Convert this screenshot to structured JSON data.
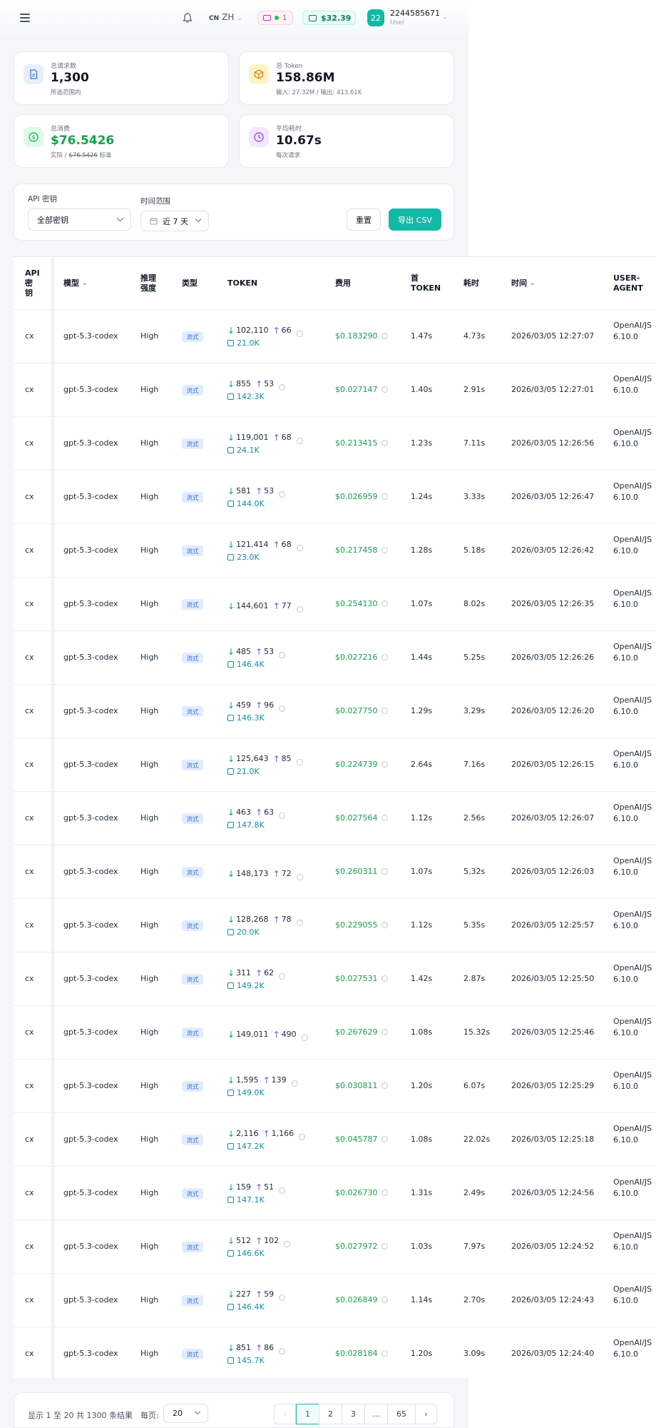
{
  "header": {
    "lang_flag": "CN",
    "lang_label": "ZH",
    "subscription_count": "1",
    "balance": "$32.39",
    "avatar_text": "22",
    "user_name": "2244585671",
    "user_role": "User"
  },
  "stats": {
    "requests": {
      "label": "总请求数",
      "value": "1,300",
      "sub": "所选范围内"
    },
    "tokens": {
      "label": "总 Token",
      "value": "158.86M",
      "sub": "输入: 27.32M / 输出: 413.61K"
    },
    "cost": {
      "label": "总消费",
      "value": "$76.5426",
      "sub_prefix": "实际 / ",
      "sub_strike": "$76.5426",
      "sub_suffix": " 标准"
    },
    "latency": {
      "label": "平均耗时",
      "value": "10.67s",
      "sub": "每次请求"
    }
  },
  "filters": {
    "api_key_label": "API 密钥",
    "api_key_value": "全部密钥",
    "time_range_label": "时间范围",
    "time_range_value": "近 7 天",
    "reset_label": "重置",
    "export_label": "导出 CSV"
  },
  "table": {
    "headers": {
      "api_key": "API\n密\n钥",
      "model": "模型",
      "reasoning": "推理\n强度",
      "type": "类型",
      "token": "TOKEN",
      "cost": "费用",
      "first_token": "首\nTOKEN",
      "duration": "耗时",
      "time": "时间",
      "user_agent": "USER-\nAGENT"
    },
    "rows": [
      {
        "key": "cx",
        "model": "gpt-5.3-codex",
        "effort": "High",
        "type": "流式",
        "in": "102,110",
        "out": "66",
        "cache": "21.0K",
        "cost": "$0.183290",
        "first": "1.47s",
        "dur": "4.73s",
        "time": "2026/03/05 12:27:07",
        "ua": "OpenAI/JS 6.10.0"
      },
      {
        "key": "cx",
        "model": "gpt-5.3-codex",
        "effort": "High",
        "type": "流式",
        "in": "855",
        "out": "53",
        "cache": "142.3K",
        "cost": "$0.027147",
        "first": "1.40s",
        "dur": "2.91s",
        "time": "2026/03/05 12:27:01",
        "ua": "OpenAI/JS 6.10.0"
      },
      {
        "key": "cx",
        "model": "gpt-5.3-codex",
        "effort": "High",
        "type": "流式",
        "in": "119,001",
        "out": "68",
        "cache": "24.1K",
        "cost": "$0.213415",
        "first": "1.23s",
        "dur": "7.11s",
        "time": "2026/03/05 12:26:56",
        "ua": "OpenAI/JS 6.10.0"
      },
      {
        "key": "cx",
        "model": "gpt-5.3-codex",
        "effort": "High",
        "type": "流式",
        "in": "581",
        "out": "53",
        "cache": "144.0K",
        "cost": "$0.026959",
        "first": "1.24s",
        "dur": "3.33s",
        "time": "2026/03/05 12:26:47",
        "ua": "OpenAI/JS 6.10.0"
      },
      {
        "key": "cx",
        "model": "gpt-5.3-codex",
        "effort": "High",
        "type": "流式",
        "in": "121,414",
        "out": "68",
        "cache": "23.0K",
        "cost": "$0.217458",
        "first": "1.28s",
        "dur": "5.18s",
        "time": "2026/03/05 12:26:42",
        "ua": "OpenAI/JS 6.10.0"
      },
      {
        "key": "cx",
        "model": "gpt-5.3-codex",
        "effort": "High",
        "type": "流式",
        "in": "144,601",
        "out": "77",
        "cache": "",
        "cost": "$0.254130",
        "first": "1.07s",
        "dur": "8.02s",
        "time": "2026/03/05 12:26:35",
        "ua": "OpenAI/JS 6.10.0"
      },
      {
        "key": "cx",
        "model": "gpt-5.3-codex",
        "effort": "High",
        "type": "流式",
        "in": "485",
        "out": "53",
        "cache": "146.4K",
        "cost": "$0.027216",
        "first": "1.44s",
        "dur": "5.25s",
        "time": "2026/03/05 12:26:26",
        "ua": "OpenAI/JS 6.10.0"
      },
      {
        "key": "cx",
        "model": "gpt-5.3-codex",
        "effort": "High",
        "type": "流式",
        "in": "459",
        "out": "96",
        "cache": "146.3K",
        "cost": "$0.027750",
        "first": "1.29s",
        "dur": "3.29s",
        "time": "2026/03/05 12:26:20",
        "ua": "OpenAI/JS 6.10.0"
      },
      {
        "key": "cx",
        "model": "gpt-5.3-codex",
        "effort": "High",
        "type": "流式",
        "in": "125,643",
        "out": "85",
        "cache": "21.0K",
        "cost": "$0.224739",
        "first": "2.64s",
        "dur": "7.16s",
        "time": "2026/03/05 12:26:15",
        "ua": "OpenAI/JS 6.10.0"
      },
      {
        "key": "cx",
        "model": "gpt-5.3-codex",
        "effort": "High",
        "type": "流式",
        "in": "463",
        "out": "63",
        "cache": "147.8K",
        "cost": "$0.027564",
        "first": "1.12s",
        "dur": "2.56s",
        "time": "2026/03/05 12:26:07",
        "ua": "OpenAI/JS 6.10.0"
      },
      {
        "key": "cx",
        "model": "gpt-5.3-codex",
        "effort": "High",
        "type": "流式",
        "in": "148,173",
        "out": "72",
        "cache": "",
        "cost": "$0.260311",
        "first": "1.07s",
        "dur": "5.32s",
        "time": "2026/03/05 12:26:03",
        "ua": "OpenAI/JS 6.10.0"
      },
      {
        "key": "cx",
        "model": "gpt-5.3-codex",
        "effort": "High",
        "type": "流式",
        "in": "128,268",
        "out": "78",
        "cache": "20.0K",
        "cost": "$0.229055",
        "first": "1.12s",
        "dur": "5.35s",
        "time": "2026/03/05 12:25:57",
        "ua": "OpenAI/JS 6.10.0"
      },
      {
        "key": "cx",
        "model": "gpt-5.3-codex",
        "effort": "High",
        "type": "流式",
        "in": "311",
        "out": "62",
        "cache": "149.2K",
        "cost": "$0.027531",
        "first": "1.42s",
        "dur": "2.87s",
        "time": "2026/03/05 12:25:50",
        "ua": "OpenAI/JS 6.10.0"
      },
      {
        "key": "cx",
        "model": "gpt-5.3-codex",
        "effort": "High",
        "type": "流式",
        "in": "149,011",
        "out": "490",
        "cache": "",
        "cost": "$0.267629",
        "first": "1.08s",
        "dur": "15.32s",
        "time": "2026/03/05 12:25:46",
        "ua": "OpenAI/JS 6.10.0"
      },
      {
        "key": "cx",
        "model": "gpt-5.3-codex",
        "effort": "High",
        "type": "流式",
        "in": "1,595",
        "out": "139",
        "cache": "149.0K",
        "cost": "$0.030811",
        "first": "1.20s",
        "dur": "6.07s",
        "time": "2026/03/05 12:25:29",
        "ua": "OpenAI/JS 6.10.0"
      },
      {
        "key": "cx",
        "model": "gpt-5.3-codex",
        "effort": "High",
        "type": "流式",
        "in": "2,116",
        "out": "1,166",
        "cache": "147.2K",
        "cost": "$0.045787",
        "first": "1.08s",
        "dur": "22.02s",
        "time": "2026/03/05 12:25:18",
        "ua": "OpenAI/JS 6.10.0"
      },
      {
        "key": "cx",
        "model": "gpt-5.3-codex",
        "effort": "High",
        "type": "流式",
        "in": "159",
        "out": "51",
        "cache": "147.1K",
        "cost": "$0.026730",
        "first": "1.31s",
        "dur": "2.49s",
        "time": "2026/03/05 12:24:56",
        "ua": "OpenAI/JS 6.10.0"
      },
      {
        "key": "cx",
        "model": "gpt-5.3-codex",
        "effort": "High",
        "type": "流式",
        "in": "512",
        "out": "102",
        "cache": "146.6K",
        "cost": "$0.027972",
        "first": "1.03s",
        "dur": "7.97s",
        "time": "2026/03/05 12:24:52",
        "ua": "OpenAI/JS 6.10.0"
      },
      {
        "key": "cx",
        "model": "gpt-5.3-codex",
        "effort": "High",
        "type": "流式",
        "in": "227",
        "out": "59",
        "cache": "146.4K",
        "cost": "$0.026849",
        "first": "1.14s",
        "dur": "2.70s",
        "time": "2026/03/05 12:24:43",
        "ua": "OpenAI/JS 6.10.0"
      },
      {
        "key": "cx",
        "model": "gpt-5.3-codex",
        "effort": "High",
        "type": "流式",
        "in": "851",
        "out": "86",
        "cache": "145.7K",
        "cost": "$0.028184",
        "first": "1.20s",
        "dur": "3.09s",
        "time": "2026/03/05 12:24:40",
        "ua": "OpenAI/JS 6.10.0"
      }
    ]
  },
  "pagination": {
    "summary": "显示 1 至 20 共 1300 条结果",
    "per_page_label": "每页:",
    "per_page_value": "20",
    "pages": [
      "1",
      "2",
      "3",
      "...",
      "65"
    ]
  },
  "icons": [
    "menu-icon",
    "bell-icon",
    "chevron-down-icon",
    "credit-card-icon",
    "wallet-icon",
    "document-icon",
    "cube-icon",
    "dollar-icon",
    "clock-icon",
    "calendar-icon",
    "arrow-down-icon",
    "arrow-up-icon",
    "info-icon",
    "cache-icon",
    "chevron-left-icon",
    "chevron-right-icon"
  ],
  "colors": {
    "accent": "#14b8a6",
    "cost_green": "#16a34a",
    "cache_blue": "#0e8fa8",
    "badge_blue": "#3b6fd8"
  }
}
